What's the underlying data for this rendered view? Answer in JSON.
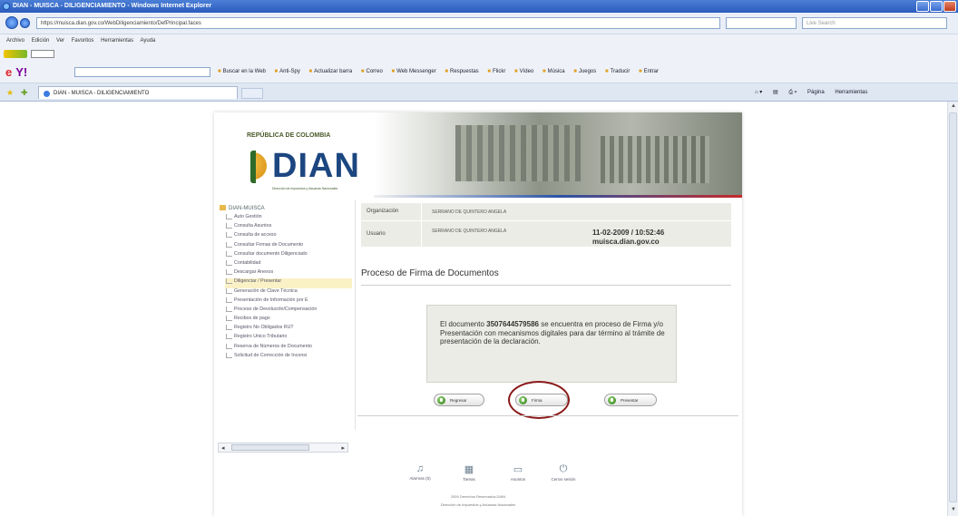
{
  "browser": {
    "title": "DIAN - MUISCA - DILIGENCIAMIENTO - Windows Internet Explorer",
    "address": "https://muisca.dian.gov.co/WebDiligenciamiento/DefPrincipal.faces",
    "search_placeholder": "Live Search",
    "menu": [
      "Archivo",
      "Edición",
      "Ver",
      "Favoritos",
      "Herramientas",
      "Ayuda"
    ],
    "toolbar_items": [
      "Buscar en la Web",
      "Anti-Spy",
      "Actualizar barra",
      "Correo",
      "Web Messenger",
      "Respuestas",
      "Flickr",
      "Vídeo",
      "Música",
      "Juegos",
      "Traducir",
      "Entrar"
    ],
    "tab_label": "DIAN - MUISCA - DILIGENCIAMIENTO",
    "right_tools": [
      "Página",
      "Herramientas"
    ]
  },
  "site": {
    "republic": "REPÚBLICA DE COLOMBIA",
    "brand": "DIAN",
    "brand_sub": "Dirección de Impuestos y Aduanas Nacionales"
  },
  "menu": {
    "root": "DIAN-MUISCA",
    "items": [
      "Auto Gestión",
      "Consulta Asuntos",
      "Consulta de acceso",
      "Consultar Firmas de Documento",
      "Consultar documento Diligenciado",
      "Contabilidad",
      "Descargar Anexos",
      "Diligenciar / Presentar",
      "Generación de Clave Técnica",
      "Presentación de Información por E",
      "Proceso de Devolución/Compensación",
      "Recibos de pago",
      "Registro No Obligados RUT",
      "Registro Único Tributario",
      "Reserva de Números de Documento",
      "Solicitud de Corrección de Inconsi"
    ],
    "active_index": 7
  },
  "info": {
    "org_label": "Organización",
    "org_value": "SERRANO DE QUINTERO ANGELA",
    "user_label": "Usuario",
    "user_value": "SERRANO DE QUINTERO ANGELA",
    "datetime": "11-02-2009 / 10:52:46",
    "host": "muisca.dian.gov.co"
  },
  "main": {
    "title": "Proceso de Firma de Documentos",
    "msg_before": "El documento ",
    "doc_number": "3507644579586",
    "msg_after": " se encuentra en proceso de Firma y/o Presentación con mecanismos digitales para dar término al trámite de presentación de la declaración.",
    "buttons": {
      "back": "Regresar",
      "sign": "Firma",
      "present": "Presentar"
    }
  },
  "footer": {
    "items": [
      "Alarmas (0)",
      "Tareas",
      "Asuntos",
      "Cerrar sesión"
    ],
    "copyright": "2009 Derechos Reservados DIAN",
    "org": "Dirección de Impuestos y Aduanas Nacionales"
  }
}
